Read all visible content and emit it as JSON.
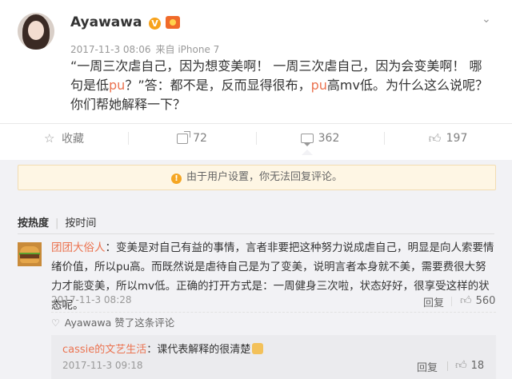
{
  "post": {
    "username": "Ayawawa",
    "verified_badge": "V",
    "timestamp": "2017-11-3 08:06",
    "source": "来自 iPhone 7",
    "content_segments": [
      {
        "text": "“一周三次虐自己，因为想变美啊！ 一周三次虐自己，因为会变美啊！ 哪句是低",
        "highlight": false
      },
      {
        "text": "pu",
        "highlight": true
      },
      {
        "text": "？”答：都不是，反而显得很布，",
        "highlight": false
      },
      {
        "text": "pu",
        "highlight": true
      },
      {
        "text": "高mv低。为什么这么说呢？你们帮她解释一下？",
        "highlight": false
      }
    ]
  },
  "actions": {
    "favorite_label": "收藏",
    "forward_count": "72",
    "comment_count": "362",
    "like_count": "197"
  },
  "notice": {
    "icon": "warning-icon",
    "text": "由于用户设置，你无法回复评论。"
  },
  "comments": {
    "sort_hot": "按热度",
    "sort_time": "按时间",
    "items": [
      {
        "user": "团团大俗人",
        "text": "：变美是对自己有益的事情，言者非要把这种努力说成虐自己，明显是向人索要情绪价值，所以pu高。而既然说是虐待自己是为了变美，说明言者本身就不美，需要费很大努力才能变美，所以mv低。正确的打开方式是：一周健身三次啦，状态好好，很享受这样的状态呢。",
        "timestamp": "2017-11-3 08:28",
        "reply_label": "回复",
        "likes": "560",
        "op_liked": "Ayawawa 赞了这条评论",
        "sub_reply": {
          "user": "cassie的文艺生活",
          "text": "：课代表解释的很清楚",
          "timestamp": "2017-11-3 09:18",
          "reply_label": "回复",
          "likes": "18"
        }
      }
    ]
  },
  "colors": {
    "accent": "#eb7350",
    "notice_bg": "#fef6e4",
    "page_bg": "#f2f2f5"
  }
}
